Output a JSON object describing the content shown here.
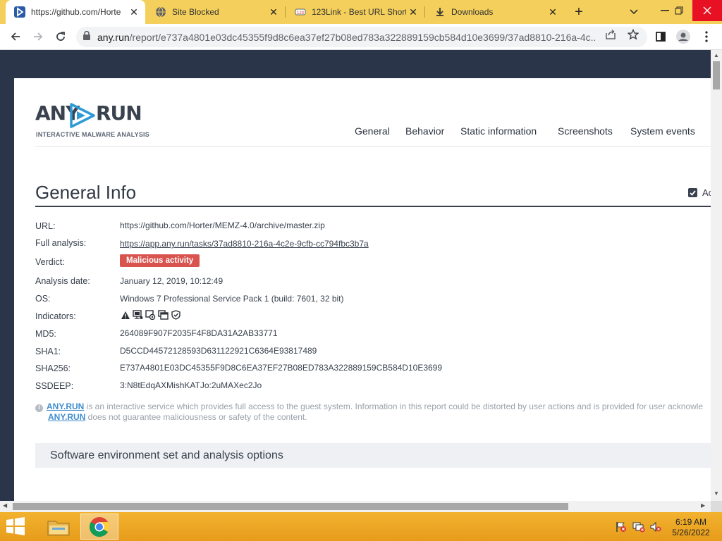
{
  "browser": {
    "tabs": [
      {
        "title": "https://github.com/Horte",
        "icon": "anyrun-favicon",
        "active": true
      },
      {
        "title": "Site Blocked",
        "icon": "globe-icon",
        "active": false
      },
      {
        "title": "123Link - Best URL Short",
        "icon": "link-favicon",
        "active": false
      },
      {
        "title": "Downloads",
        "icon": "download-icon",
        "active": false
      }
    ],
    "address": {
      "host": "any.run",
      "path": "/report/e737a4801e03dc45355f9d8c6ea37ef27b08ed783a322889159cb584d10e3699/37ad8810-216a-4c..."
    }
  },
  "page": {
    "logo": {
      "any": "ANY",
      "run": "RUN",
      "tagline": "INTERACTIVE MALWARE ANALYSIS"
    },
    "nav": [
      "General",
      "Behavior",
      "Static information",
      "Screenshots",
      "System events"
    ],
    "heading": "General Info",
    "adv_label": "Ac",
    "info": {
      "url_label": "URL:",
      "url_value": "https://github.com/Horter/MEMZ-4.0/archive/master.zip",
      "full_label": "Full analysis:",
      "full_value": "https://app.any.run/tasks/37ad8810-216a-4c2e-9cfb-cc794fbc3b7a",
      "verdict_label": "Verdict:",
      "verdict_value": "Malicious activity",
      "date_label": "Analysis date:",
      "date_value": "January 12, 2019, 10:12:49",
      "os_label": "OS:",
      "os_value": "Windows 7 Professional Service Pack 1 (build: 7601, 32 bit)",
      "indicators_label": "Indicators:",
      "indicator_icons": [
        "warning-icon",
        "screen-network-icon",
        "process-icon",
        "windows-icon",
        "shield-icon"
      ],
      "md5_label": "MD5:",
      "md5_value": "264089F907F2035F4F8DA31A2AB33771",
      "sha1_label": "SHA1:",
      "sha1_value": "D5CCD44572128593D631122921C6364E93817489",
      "sha256_label": "SHA256:",
      "sha256_value": "E737A4801E03DC45355F9D8C6EA37EF27B08ED783A322889159CB584D10E3699",
      "ssdeep_label": "SSDEEP:",
      "ssdeep_value": "3:N8tEdqAXMishKATJo:2uMAXec2Jo"
    },
    "note": {
      "link": "ANY.RUN",
      "line1": " is an interactive service which provides full access to the guest system. Information in this report could be distorted by user actions and is provided for user acknowle",
      "line2": " does not guarantee maliciousness or safety of the content."
    },
    "section_title": "Software environment set and analysis options"
  },
  "taskbar": {
    "time": "6:19 AM",
    "date": "5/26/2022"
  },
  "colors": {
    "taskbar": "#e9a524",
    "verdict": "#d9534f",
    "logo_accent": "#2e9ad6",
    "page_dark": "#2b3549"
  }
}
